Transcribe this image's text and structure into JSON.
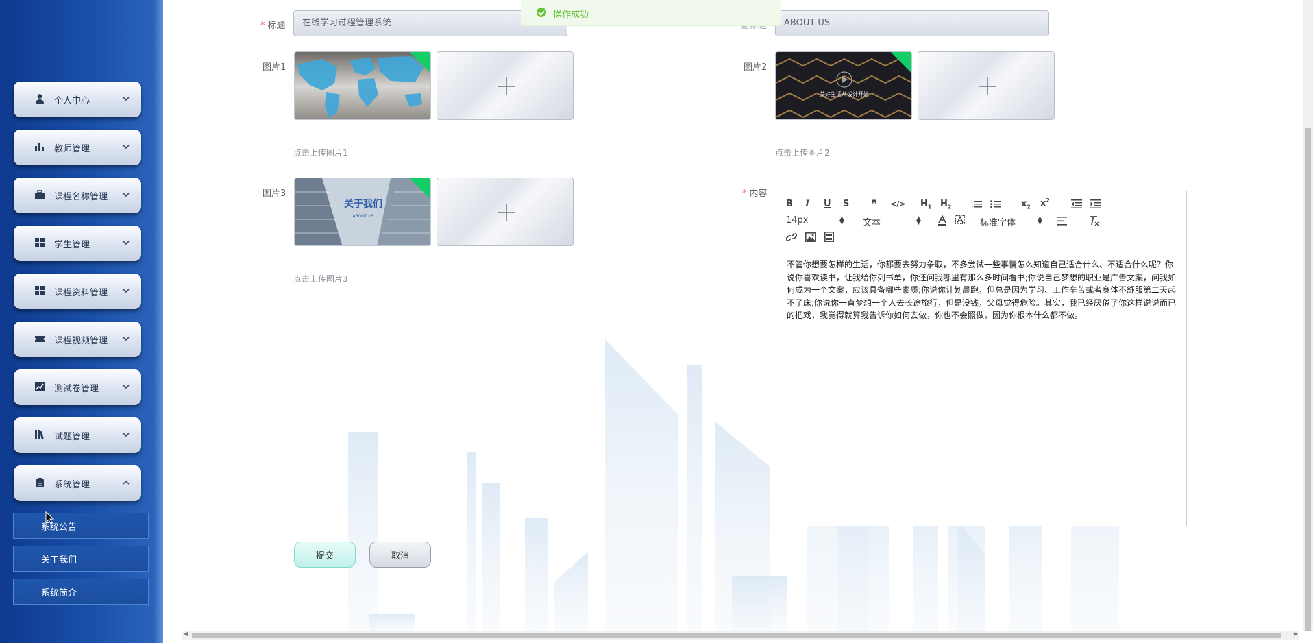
{
  "sidebar": {
    "menu": [
      {
        "label": "个人中心",
        "icon": "user-icon"
      },
      {
        "label": "教师管理",
        "icon": "bar-chart-icon"
      },
      {
        "label": "课程名称管理",
        "icon": "briefcase-icon"
      },
      {
        "label": "学生管理",
        "icon": "grid-icon"
      },
      {
        "label": "课程资料管理",
        "icon": "grid-icon"
      },
      {
        "label": "课程视频管理",
        "icon": "ticket-icon"
      },
      {
        "label": "测试卷管理",
        "icon": "trend-chart-icon"
      },
      {
        "label": "试题管理",
        "icon": "books-icon"
      },
      {
        "label": "系统管理",
        "icon": "clipboard-icon",
        "expanded": true
      }
    ],
    "submenu": [
      {
        "label": "系统公告"
      },
      {
        "label": "关于我们"
      },
      {
        "label": "系统简介"
      }
    ]
  },
  "toast": {
    "message": "操作成功",
    "color": "#67c23a"
  },
  "form": {
    "title_label": "标题",
    "title_value": "在线学习过程管理系统",
    "subtitle_label": "副标题",
    "subtitle_value": "ABOUT US",
    "image1_label": "图片1",
    "image1_tip": "点击上传图片1",
    "image2_label": "图片2",
    "image2_tip": "点击上传图片2",
    "image2_caption": "美好生活从设计开始",
    "image3_label": "图片3",
    "image3_tip": "点击上传图片3",
    "image3_title": "关于我们",
    "image3_sub": "ABOUT US",
    "content_label": "内容",
    "submit_label": "提交",
    "cancel_label": "取消"
  },
  "editor": {
    "font_size": "14px",
    "header_select": "文本",
    "font_family": "标准字体",
    "content": "不管你想要怎样的生活，你都要去努力争取，不多尝试一些事情怎么知道自己适合什么、不适合什么呢？你说你喜欢读书，让我给你列书单，你还问我哪里有那么多时间看书;你说自己梦想的职业是广告文案，问我如何成为一个文案，应该具备哪些素质;你说你计划晨跑，但总是因为学习、工作辛苦或者身体不舒服第二天起不了床;你说你一直梦想一个人去长途旅行，但是没钱，父母觉得危险。其实，我已经厌倦了你这样说说而已的把戏，我觉得就算我告诉你如何去做，你也不会照做，因为你根本什么都不做。"
  },
  "colors": {
    "sidebar": "#1a4fa8",
    "accent_success": "#13ce66",
    "required": "#f56c6c"
  }
}
